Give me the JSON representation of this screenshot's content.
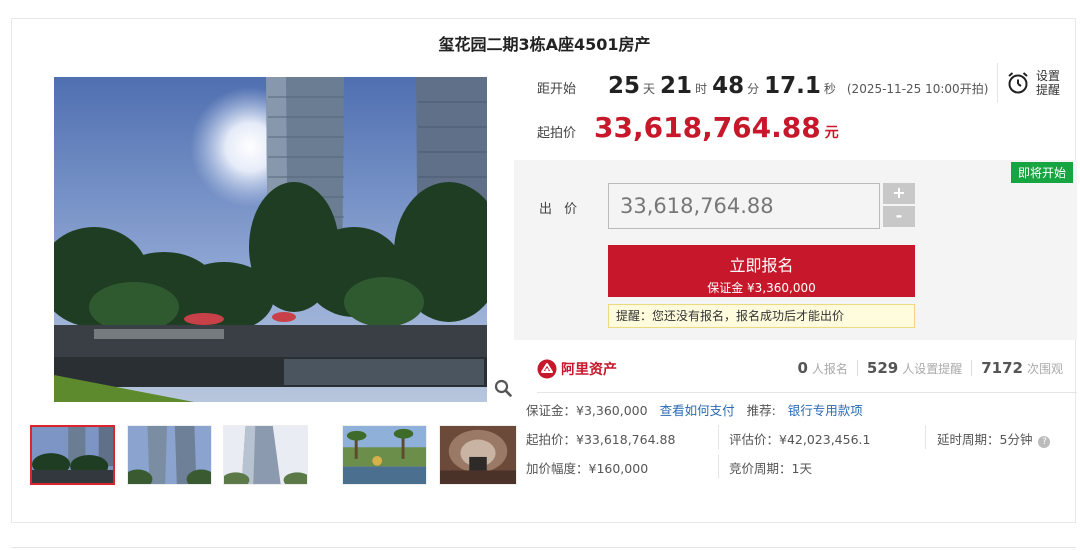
{
  "title": "玺花园二期3栋A座4501房产",
  "countdown": {
    "label": "距开始",
    "days": "25",
    "days_unit": "天",
    "hours": "21",
    "hours_unit": "时",
    "minutes": "48",
    "minutes_unit": "分",
    "seconds": "17.1",
    "seconds_unit": "秒",
    "start_time": "(2025-11-25 10:00开拍)"
  },
  "remind": {
    "label": "设置提醒",
    "icon": "alarm-clock-icon"
  },
  "start_price": {
    "label": "起拍价",
    "value": "33,618,764.88",
    "unit": "元"
  },
  "bid": {
    "badge": "即将开始",
    "label": "出 价",
    "input_value": "33,618,764.88",
    "plus": "+",
    "minus": "-",
    "signup_label": "立即报名",
    "deposit_label": "保证金 ¥3,360,000",
    "tip": "提醒：您还没有报名，报名成功后才能出价"
  },
  "provider": {
    "name": "阿里资产",
    "icon": "ali-assets-logo-icon",
    "signups": "0",
    "signups_label": "人报名",
    "reminders": "529",
    "reminders_label": "人设置提醒",
    "views": "7172",
    "views_label": "次围观"
  },
  "info": {
    "deposit": "保证金：¥3,360,000",
    "how_to_pay": "查看如何支付",
    "recommend_label": "推荐:",
    "recommend_link": "银行专用款项",
    "start_price": "起拍价：¥33,618,764.88",
    "appraisal": "评估价：¥42,023,456.1",
    "delay": "延时周期：5分钟",
    "increment": "加价幅度：¥160,000",
    "bid_period": "竞价周期：1天"
  },
  "gallery": {
    "zoom_icon": "magnifier-icon",
    "thumb_count": 5,
    "active_index": 0
  },
  "colors": {
    "accent_red": "#c7182b",
    "badge_green": "#17a541",
    "link_blue": "#2a6ab5",
    "tip_bg": "#fffbdd"
  }
}
